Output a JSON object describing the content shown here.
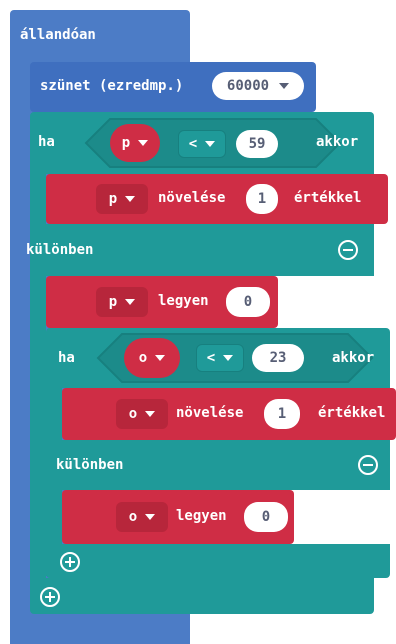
{
  "colors": {
    "loop_blue": "#4c7cc6",
    "basic_blue": "#3f6fbf",
    "logic_teal": "#1f9a99",
    "variable_red": "#cf2d45",
    "variable_red_dark": "#b7263b"
  },
  "forever": {
    "label": "állandóan"
  },
  "pause": {
    "label": "szünet (ezredmp.)",
    "value": "60000"
  },
  "outer_if": {
    "if_label": "ha",
    "then_label": "akkor",
    "var": "p",
    "op": "<",
    "compare_value": "59",
    "change": {
      "var": "p",
      "label": "növelése",
      "value": "1",
      "suffix": "értékkel"
    },
    "else_label": "különben",
    "set": {
      "var": "p",
      "label": "legyen",
      "value": "0"
    }
  },
  "inner_if": {
    "if_label": "ha",
    "then_label": "akkor",
    "var": "o",
    "op": "<",
    "compare_value": "23",
    "change": {
      "var": "o",
      "label": "növelése",
      "value": "1",
      "suffix": "értékkel"
    },
    "else_label": "különben",
    "set": {
      "var": "o",
      "label": "legyen",
      "value": "0"
    }
  },
  "icons": {
    "remove": "minus-circle-icon",
    "add": "plus-circle-icon",
    "dropdown": "triangle-down-icon"
  }
}
